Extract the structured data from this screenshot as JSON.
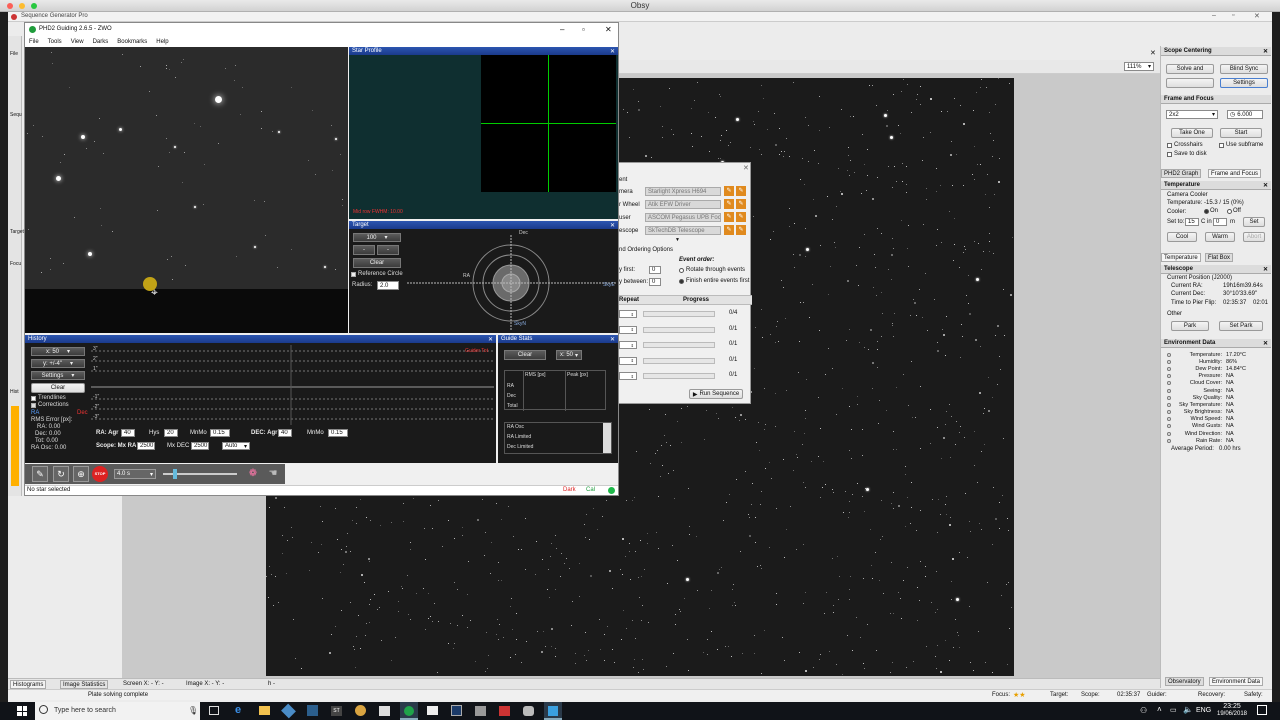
{
  "mac": {
    "title": "Obsy"
  },
  "sgp": {
    "title": "Sequence Generator Pro",
    "zoom": "111%",
    "status": "Plate solving complete",
    "tabs": [
      "Histograms",
      "Image Statistics"
    ],
    "screen_coords": "Screen X: - Y: -",
    "image_coords": "Image X: - Y: -",
    "dash": "h -",
    "left_labels": [
      "File",
      "Sequ",
      "Target",
      "Focu",
      "Hist"
    ],
    "sb_focus": "Focus:",
    "sb_target": "Target:",
    "sb_scope": "Scope:",
    "sb_time": "02:35:37",
    "sb_guider": "Guider:",
    "sb_recovery": "Recovery:",
    "sb_safety": "Safety:"
  },
  "phd": {
    "title": "PHD2 Guiding 2.6.5 - ZWO",
    "menu": [
      "File",
      "Tools",
      "View",
      "Darks",
      "Bookmarks",
      "Help"
    ],
    "star_profile": {
      "title": "Star Profile",
      "hfd": "Mid row FWHM: 10.00"
    },
    "target": {
      "title": "Target",
      "scale": "100",
      "clear": "Clear",
      "ref_circle": "Reference Circle",
      "radius_label": "Radius:",
      "radius": "2.0",
      "dec": "Dec",
      "ra": "RA",
      "skyE": "SkyE",
      "skyN": "SkyN"
    },
    "history": {
      "title": "History",
      "x": "x: 50",
      "y": "y: +/-4\"",
      "settings": "Settings",
      "clear": "Clear",
      "trendlines": "Trendlines",
      "corrections": "Corrections",
      "ra": "RA",
      "dec": "Dec",
      "rms_label": "RMS Error [px]:",
      "ra_val": "RA: 0.00",
      "dec_val": "Dec: 0.00",
      "tot_val": "Tot: 0.00",
      "osc_val": "RA Osc: 0.00",
      "y_labels": [
        "3\"",
        "2\"",
        "1\"",
        "-1\"",
        "-2\"",
        "-3\""
      ],
      "corr_legend": "Guider Tot",
      "ra_agr_label": "RA: Agr",
      "ra_agr": "40",
      "hys_label": "Hys",
      "hys": "20",
      "mnmo_label": "MnMo",
      "mnmo": "0.15",
      "dec_agr_label": "DEC: Agr",
      "dec_agr": "40",
      "dec_mnmo_label": "MnMo",
      "dec_mnmo": "0.15",
      "scope_label": "Scope: Mx RA",
      "mxra": "2500",
      "mxdec_label": "Mx DEC",
      "mxdec": "2500",
      "auto": "Auto"
    },
    "guide_stats": {
      "title": "Guide Stats",
      "clear": "Clear",
      "x": "x: 50",
      "cols": [
        "",
        "RMS [px]",
        "Peak [px]"
      ],
      "rows": [
        "RA",
        "Dec",
        "Total"
      ],
      "list": [
        "RA Osc",
        "RA Limited",
        "Dec Limited"
      ]
    },
    "toolbar": {
      "exposure": "4.0 s"
    },
    "status": {
      "text": "No star selected",
      "dark": "Dark",
      "cal": "Cal"
    }
  },
  "seq": {
    "section": "ent",
    "equipment": [
      {
        "label": "mera",
        "value": "Starlight Xpress H694"
      },
      {
        "label": "r Wheel",
        "value": "Atik EFW Driver"
      },
      {
        "label": "user",
        "value": "ASCOM Pegasus UPB Focu"
      },
      {
        "label": "escope",
        "value": "SkTechDB Telescope"
      }
    ],
    "ordering_title": "nd Ordering Options",
    "event_order": "Event order:",
    "opt1": "Rotate through events",
    "opt2": "Finish entire events first",
    "first_label": "y first:",
    "first_val": "0",
    "between_label": "y between:",
    "between_val": "0",
    "cols": [
      "Repeat",
      "Progress"
    ],
    "progress": [
      "0/4",
      "0/1",
      "0/1",
      "0/1",
      "0/1"
    ],
    "run": "Run Sequence"
  },
  "right": {
    "scope_centering": {
      "title": "Scope Centering",
      "solve": "Solve and",
      "blind": "Blind Sync",
      "settings": "Settings"
    },
    "frame_focus": {
      "title": "Frame and Focus",
      "binning": "2x2",
      "exposure": "6.000",
      "take_one": "Take One",
      "start": "Start",
      "crosshairs": "Crosshairs",
      "subframe": "Use subframe",
      "save": "Save to disk",
      "tab1": "PHD2 Graph",
      "tab2": "Frame and Focus"
    },
    "temperature": {
      "title": "Temperature",
      "cooler_label": "Camera Cooler",
      "temp": "Temperature: -15.3 / 15 (0%)",
      "cooler": "Cooler:",
      "on": "On",
      "off": "Off",
      "set_to": "Set to:",
      "set_val": "15",
      "c_in": "C in",
      "min_val": "0",
      "m": "m",
      "set": "Set",
      "cool": "Cool",
      "warm": "Warm",
      "abort": "Abort",
      "tab1": "Temperature",
      "tab2": "Flat Box"
    },
    "telescope": {
      "title": "Telescope",
      "pos": "Current Position (J2000)",
      "ra_label": "Current RA:",
      "ra": "19h16m39.64s",
      "dec_label": "Current Dec:",
      "dec": "30°10'33.69\"",
      "flip_label": "Time to Pier Flip:",
      "flip": "02:35:37",
      "flip2": "02:01",
      "other": "Other",
      "park": "Park",
      "set_park": "Set Park"
    },
    "env": {
      "title": "Environment Data",
      "items": [
        {
          "k": "Temperature:",
          "v": "17.20°C"
        },
        {
          "k": "Humidity:",
          "v": "86%"
        },
        {
          "k": "Dew Point:",
          "v": "14.84°C"
        },
        {
          "k": "Pressure:",
          "v": "NA"
        },
        {
          "k": "Cloud Cover:",
          "v": "NA"
        },
        {
          "k": "Seeing:",
          "v": "NA"
        },
        {
          "k": "Sky Quality:",
          "v": "NA"
        },
        {
          "k": "Sky Temperature:",
          "v": "NA"
        },
        {
          "k": "Sky Brightness:",
          "v": "NA"
        },
        {
          "k": "Wind Speed:",
          "v": "NA"
        },
        {
          "k": "Wind Gusts:",
          "v": "NA"
        },
        {
          "k": "Wind Direction:",
          "v": "NA"
        },
        {
          "k": "Rain Rate:",
          "v": "NA"
        }
      ],
      "avg_label": "Average Period:",
      "avg": "0.00 hrs"
    },
    "bottom_tabs": [
      "Observatory",
      "Environment Data"
    ]
  },
  "taskbar": {
    "search": "Type here to search",
    "lang": "ENG",
    "time": "23:25",
    "date": "19/06/2018"
  }
}
